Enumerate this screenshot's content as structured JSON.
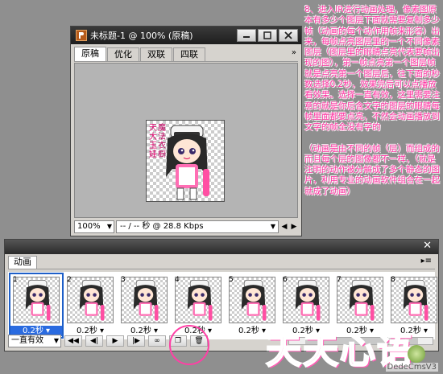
{
  "doc_window": {
    "title": "未标题-1 @ 100% (原稿)",
    "tabs": [
      "原稿",
      "优化",
      "双联",
      "四联"
    ],
    "zoom": "100%",
    "speed": "-- / -- 秒 @ 28.8 Kbps",
    "image_left_text": "天大玉娃",
    "image_right_text": "魔法衣橱"
  },
  "note": {
    "para1": "8、进入IR进行动画处理，像素图原本有多少个图层下面就需要复制多少帧（动画的每个动作用帧来形容）出来，每帧点亮图层里的一个不同像素图层（图层里的眼睛点亮代表要帧出现的图），第一帧点亮第一个图层帧就是点亮第一个图层后，往下面的秒数选择0.2秒，效果完后可以点播放看效果。选择一直有效，这里需要注意的就是你后含文字的图层的眼睛每帧里面都要点亮，不然会动画播放到文字的帧全没有字的",
    "para2": "（动画是由不同的帧（层）而组成的而且每个层的图像都不一样，（就是注明的动作被分解成了多个静态的图片，利用专业的动画软件组合在一起就成了动画）"
  },
  "anim_panel": {
    "tab": "动画",
    "loop": "一直有效",
    "frames": [
      {
        "num": "1",
        "time": "0.2秒"
      },
      {
        "num": "2",
        "time": "0.2秒"
      },
      {
        "num": "3",
        "time": "0.2秒"
      },
      {
        "num": "4",
        "time": "0.2秒"
      },
      {
        "num": "5",
        "time": "0.2秒"
      },
      {
        "num": "6",
        "time": "0.2秒"
      },
      {
        "num": "7",
        "time": "0.2秒"
      },
      {
        "num": "8",
        "time": "0.2秒"
      }
    ],
    "selected_frame": 1
  },
  "watermark": {
    "big": "天天心语",
    "small": "DedeCmsV3"
  },
  "icons": [
    "ps-icon",
    "minimize-icon",
    "maximize-icon",
    "close-icon",
    "first-frame-icon",
    "prev-frame-icon",
    "play-icon",
    "next-frame-icon",
    "tween-icon",
    "new-frame-icon",
    "delete-frame-icon"
  ],
  "colors": {
    "note": "#ff2fa0",
    "selected": "#2a6be0",
    "circle": "#ff3fa5"
  }
}
